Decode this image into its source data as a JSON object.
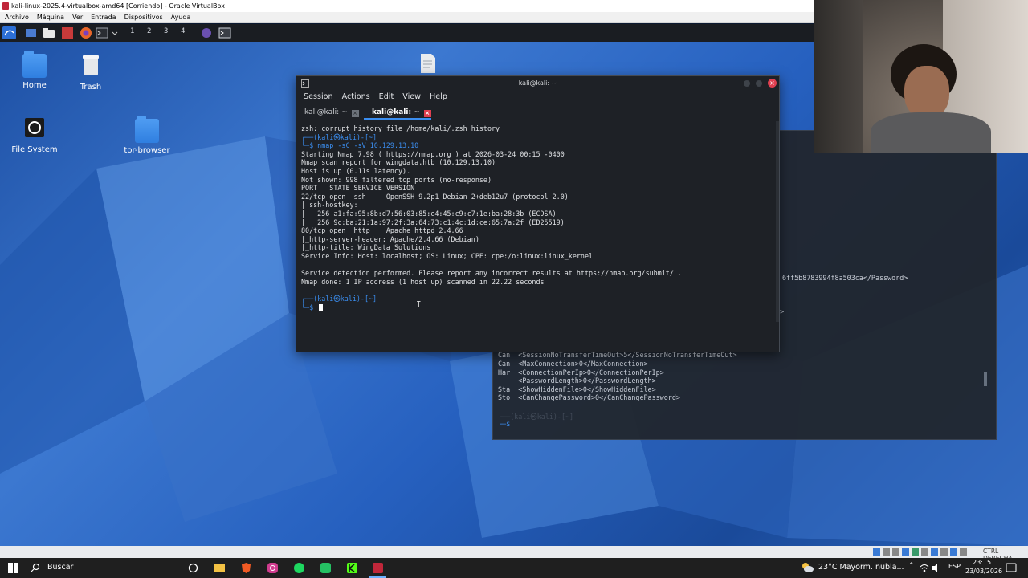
{
  "vbox": {
    "title": "kali-linux-2025.4-virtualbox-amd64 [Corriendo] - Oracle VirtualBox",
    "menu": [
      "Archivo",
      "Máquina",
      "Ver",
      "Entrada",
      "Dispositivos",
      "Ayuda"
    ]
  },
  "kali_panel": {
    "workspaces": [
      "1",
      "2",
      "3",
      "4"
    ]
  },
  "desktop_icons": [
    {
      "label": "Home",
      "icon": "home-folder-icon"
    },
    {
      "label": "Trash",
      "icon": "trash-icon"
    },
    {
      "label": "File System",
      "icon": "drive-icon"
    },
    {
      "label": "tor-browser",
      "icon": "folder-icon"
    }
  ],
  "terminal": {
    "window_title": "kali@kali: ~",
    "menu": [
      "Session",
      "Actions",
      "Edit",
      "View",
      "Help"
    ],
    "tabs": [
      "kali@kali: ~",
      "kali@kali: ~"
    ],
    "lines": [
      "zsh: corrupt history file /home/kali/.zsh_history",
      "┌──(kali㉿kali)-[~]",
      "└─$ nmap -sC -sV 10.129.13.10",
      "Starting Nmap 7.98 ( https://nmap.org ) at 2026-03-24 00:15 -0400",
      "Nmap scan report for wingdata.htb (10.129.13.10)",
      "Host is up (0.11s latency).",
      "Not shown: 998 filtered tcp ports (no-response)",
      "PORT   STATE SERVICE VERSION",
      "22/tcp open  ssh     OpenSSH 9.2p1 Debian 2+deb12u7 (protocol 2.0)",
      "| ssh-hostkey:",
      "|   256 a1:fa:95:8b:d7:56:03:85:e4:45:c9:c7:1e:ba:28:3b (ECDSA)",
      "|_  256 9c:ba:21:1a:97:2f:3a:64:73:c1:4c:1d:ce:65:7a:2f (ED25519)",
      "80/tcp open  http    Apache httpd 2.4.66",
      "|_http-server-header: Apache/2.4.66 (Debian)",
      "|_http-title: WingData Solutions",
      "Service Info: Host: localhost; OS: Linux; CPE: cpe:/o:linux:linux_kernel",
      "",
      "Service detection performed. Please report any incorrect results at https://nmap.org/submit/ .",
      "Nmap done: 1 IP address (1 host up) scanned in 22.22 seconds",
      "",
      "┌──(kali㉿kali)-[~]",
      "└─$ "
    ]
  },
  "back_terminal": {
    "lines": [
      "6ff5b8783994f8a503ca</Password>",
      "on>",
      "Can  <SessionNoTransferTimeOut>5</SessionNoTransferTimeOut>",
      "Can  <MaxConnection>0</MaxConnection>",
      "Har  <ConnectionPerIp>0</ConnectionPerIp>",
      "     <PasswordLength>0</PasswordLength>",
      "Sta  <ShowHiddenFile>0</ShowHiddenFile>",
      "Sto  <CanChangePassword>0</CanChangePassword>"
    ],
    "prompt_top": "┌──(kali㉿kali)-[~]",
    "prompt_bottom": "└─$ "
  },
  "taskbar": {
    "search_label": "Buscar",
    "weather": "23°C  Mayorm. nubla...",
    "language": "ESP",
    "time": "23:15",
    "date": "23/03/2026",
    "host_key": "CTRL DERECHA"
  }
}
